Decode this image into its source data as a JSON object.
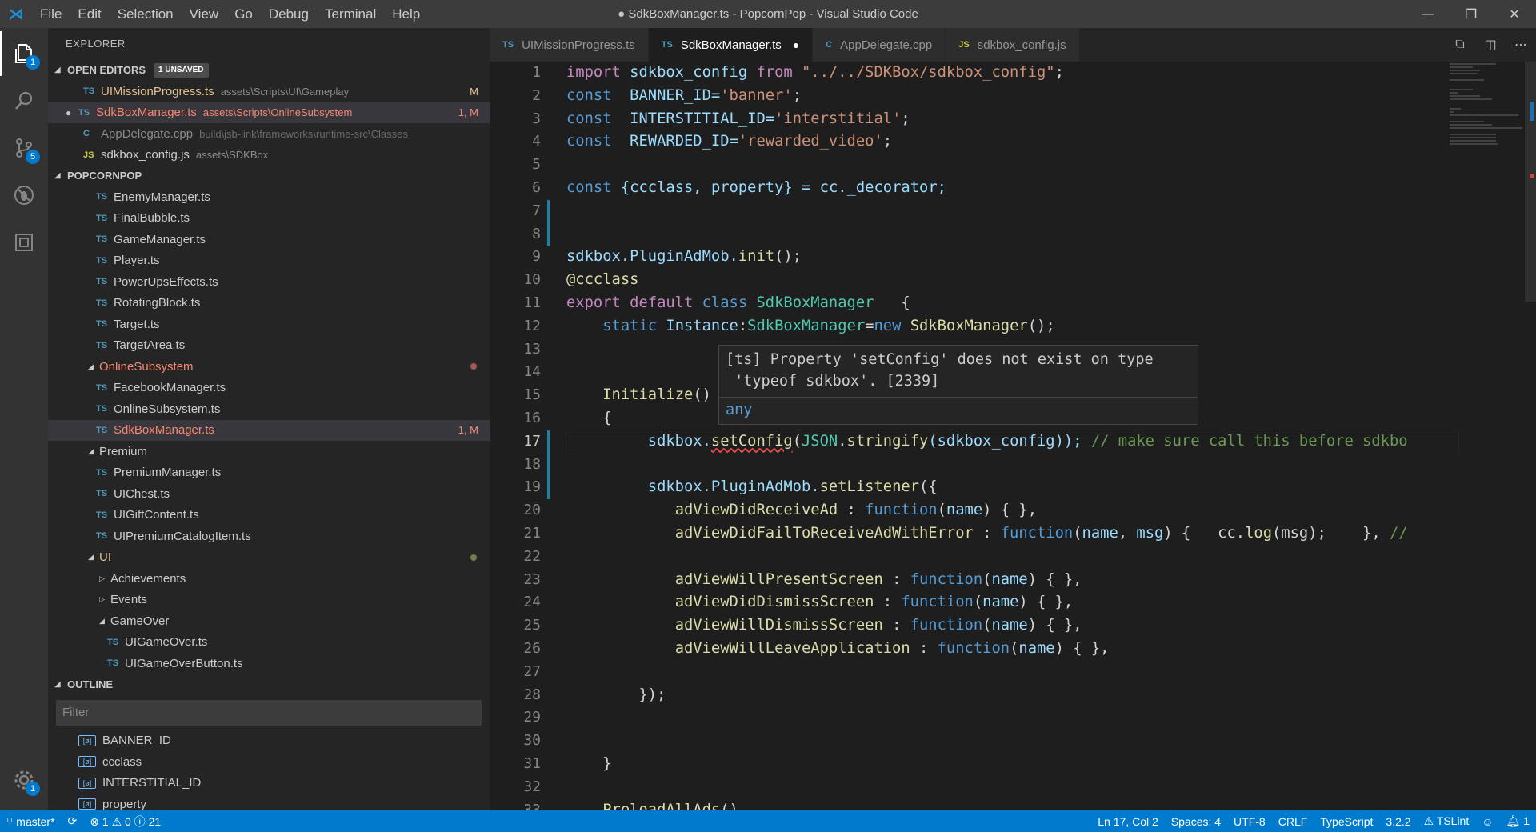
{
  "title_bar": {
    "menus": [
      "File",
      "Edit",
      "Selection",
      "View",
      "Go",
      "Debug",
      "Terminal",
      "Help"
    ],
    "title": "● SdkBoxManager.ts - PopcornPop - Visual Studio Code",
    "window_controls": [
      "—",
      "❐",
      "✕"
    ]
  },
  "activity_bar": {
    "explorer_badge": "1",
    "scm_badge": "5",
    "settings_badge": "1"
  },
  "sidebar": {
    "title": "EXPLORER",
    "open_editors": {
      "label": "OPEN EDITORS",
      "badge": "1 UNSAVED",
      "items": [
        {
          "lang": "TS",
          "name": "UIMissionProgress.ts",
          "path": "assets\\Scripts\\UI\\Gameplay",
          "status": "M"
        },
        {
          "lang": "TS",
          "name": "SdkBoxManager.ts",
          "path": "assets\\Scripts\\OnlineSubsystem",
          "status": "1, M"
        },
        {
          "lang": "C",
          "name": "AppDelegate.cpp",
          "path": "build\\jsb-link\\frameworks\\runtime-src\\Classes",
          "status": ""
        },
        {
          "lang": "JS",
          "name": "sdkbox_config.js",
          "path": "assets\\SDKBox",
          "status": ""
        }
      ]
    },
    "project": {
      "label": "POPCORNPOP",
      "items": [
        {
          "name": "EnemyManager.ts"
        },
        {
          "name": "FinalBubble.ts"
        },
        {
          "name": "GameManager.ts"
        },
        {
          "name": "Player.ts"
        },
        {
          "name": "PowerUpsEffects.ts"
        },
        {
          "name": "RotatingBlock.ts"
        },
        {
          "name": "Target.ts"
        },
        {
          "name": "TargetArea.ts"
        },
        {
          "name": "OnlineSubsystem"
        },
        {
          "name": "FacebookManager.ts"
        },
        {
          "name": "OnlineSubsystem.ts"
        },
        {
          "name": "SdkBoxManager.ts",
          "status": "1, M"
        },
        {
          "name": "Premium"
        },
        {
          "name": "PremiumManager.ts"
        },
        {
          "name": "UIChest.ts"
        },
        {
          "name": "UIGiftContent.ts"
        },
        {
          "name": "UIPremiumCatalogItem.ts"
        },
        {
          "name": "UI"
        },
        {
          "name": "Achievements"
        },
        {
          "name": "Events"
        },
        {
          "name": "GameOver"
        },
        {
          "name": "UIGameOver.ts"
        },
        {
          "name": "UIGameOverButton.ts"
        }
      ]
    },
    "outline": {
      "label": "OUTLINE",
      "filter_placeholder": "Filter",
      "items": [
        "BANNER_ID",
        "ccclass",
        "INTERSTITIAL_ID",
        "property"
      ]
    }
  },
  "tabs": [
    {
      "lang": "TS",
      "label": "UIMissionProgress.ts"
    },
    {
      "lang": "TS",
      "label": "SdkBoxManager.ts"
    },
    {
      "lang": "C",
      "label": "AppDelegate.cpp"
    },
    {
      "lang": "JS",
      "label": "sdkbox_config.js"
    }
  ],
  "editor": {
    "line_numbers": [
      "1",
      "2",
      "3",
      "4",
      "5",
      "6",
      "7",
      "8",
      "9",
      "10",
      "11",
      "12",
      "13",
      "14",
      "15",
      "16",
      "17",
      "18",
      "19",
      "20",
      "21",
      "22",
      "23",
      "24",
      "25",
      "26",
      "27",
      "28",
      "29",
      "30",
      "31",
      "32",
      "33"
    ],
    "hover": {
      "message": "[ts] Property 'setConfig' does not exist on type\n 'typeof sdkbox'. [2339]",
      "type": "any"
    },
    "code": {
      "l1_a": "import",
      "l1_b": " sdkbox_config ",
      "l1_c": "from",
      "l1_d": " \"../../SDKBox/sdkbox_config\"",
      "l1_e": ";",
      "l2_a": "const",
      "l2_b": "  BANNER_ID=",
      "l2_c": "'banner'",
      "l2_d": ";",
      "l3_a": "const",
      "l3_b": "  INTERSTITIAL_ID=",
      "l3_c": "'interstitial'",
      "l3_d": ";",
      "l4_a": "const",
      "l4_b": "  REWARDED_ID=",
      "l4_c": "'rewarded_video'",
      "l4_d": ";",
      "l6_a": "const",
      "l6_b": " {ccclass, ",
      "l6_c": "property",
      "l6_d": "} = cc._decorator;",
      "l9_a": "sdkbox.PluginAdMob.",
      "l9_b": "init",
      "l9_c": "();",
      "l10": "@ccclass",
      "l11_a": "export",
      "l11_b": " default ",
      "l11_c": "class",
      "l11_d": " SdkBoxManager",
      "l11_e": "   {",
      "l12_a": "    static",
      "l12_b": " Instance",
      "l12_c": ":",
      "l12_d": "SdkBoxManager",
      "l12_e": "=",
      "l12_f": "new",
      "l12_g": " SdkBoxManager",
      "l12_h": "();",
      "l15_a": "    ",
      "l15_b": "Initialize",
      "l15_c": "()",
      "l16": "    {",
      "l17_a": "         sdkbox.",
      "l17_b": "setConfig",
      "l17_c": "(",
      "l17_d": "JSON",
      "l17_e": ".",
      "l17_f": "stringify",
      "l17_g": "(sdkbox_config)); ",
      "l17_h": "// make sure call this before sdkbo",
      "l19_a": "         sdkbox.PluginAdMob.",
      "l19_b": "setListener",
      "l19_c": "({",
      "l20_a": "            ",
      "l20_b": "adViewDidReceiveAd",
      "l20_c": " : ",
      "l20_d": "function",
      "l20_e": "(",
      "l20_f": "name",
      "l20_g": ") { },",
      "l21_a": "            ",
      "l21_b": "adViewDidFailToReceiveAdWithError",
      "l21_c": " : ",
      "l21_d": "function",
      "l21_e": "(",
      "l21_f": "name",
      "l21_g": ", ",
      "l21_h": "msg",
      "l21_i": ") {   cc.",
      "l21_j": "log",
      "l21_k": "(msg);    }, ",
      "l21_l": "//",
      "l23_a": "            ",
      "l23_b": "adViewWillPresentScreen",
      "l23_c": " : ",
      "l23_d": "function",
      "l23_e": "(",
      "l23_f": "name",
      "l23_g": ") { },",
      "l24_a": "            ",
      "l24_b": "adViewDidDismissScreen",
      "l24_c": " : ",
      "l24_d": "function",
      "l24_e": "(",
      "l24_f": "name",
      "l24_g": ") { },",
      "l25_a": "            ",
      "l25_b": "adViewWillDismissScreen",
      "l25_c": " : ",
      "l25_d": "function",
      "l25_e": "(",
      "l25_f": "name",
      "l25_g": ") { },",
      "l26_a": "            ",
      "l26_b": "adViewWillLeaveApplication",
      "l26_c": " : ",
      "l26_d": "function",
      "l26_e": "(",
      "l26_f": "name",
      "l26_g": ") { },",
      "l28": "        });",
      "l31": "    }",
      "l33_a": "    ",
      "l33_b": "PreloadAllAds",
      "l33_c": "()"
    }
  },
  "status_bar": {
    "branch": "master*",
    "errors": "1",
    "warnings": "0",
    "infos": "21",
    "position": "Ln 17, Col 2",
    "spaces": "Spaces: 4",
    "encoding": "UTF-8",
    "eol": "CRLF",
    "language": "TypeScript",
    "version": "3.2.2",
    "linter": "TSLint",
    "notifications": "1"
  },
  "colors": {
    "accent": "#007acc",
    "error": "#f48771",
    "modified": "#e2c08d"
  }
}
